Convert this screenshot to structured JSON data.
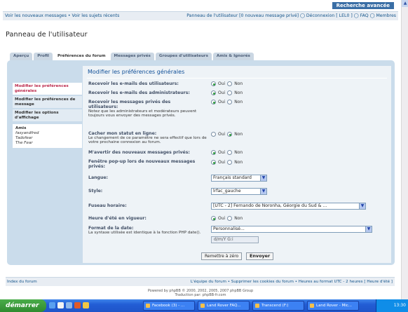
{
  "header": {
    "advanced_search": "Recherche avancée"
  },
  "navlinks": {
    "left": "Voir les nouveaux messages • Voir les sujets récents",
    "right": "Panneau de l'utilisateur [0 nouveau message privé] ◯ Déconnexion [ LEL0 ] ◯ FAQ ◯ Membres"
  },
  "page_title": "Panneau de l'utilisateur",
  "tabs": [
    "Aperçu",
    "Profil",
    "Préférences du forum",
    "Messages privés",
    "Groupes d'utilisateurs",
    "Amis & Ignorés"
  ],
  "sidebar": {
    "items": [
      "Modifier les préférences générales",
      "Modifier les préférences de message",
      "Modifier les options d'affichage"
    ],
    "friends_title": "Amis",
    "friends": [
      "fasyandfred",
      "Tadofear",
      "The Fear"
    ]
  },
  "form": {
    "heading": "Modifier les préférences générales",
    "rows": {
      "users_email": {
        "label": "Recevoir les e-mails des utilisateurs:"
      },
      "admin_email": {
        "label": "Recevoir les e-mails des administrateurs:"
      },
      "pm_users": {
        "label": "Recevoir les messages privés des utilisateurs:",
        "note": "Notez que les administrateurs et modérateurs peuvent toujours vous envoyer des messages privés."
      },
      "hide_online": {
        "label": "Cacher mon statut en ligne:",
        "note": "Le changement de ce paramètre ne sera effectif que lors de votre prochaine connexion au forum."
      },
      "notify_pm": {
        "label": "M'avertir des nouveaux messages privés:"
      },
      "popup_pm": {
        "label": "Fenêtre pop-up lors de nouveaux messages privés:"
      },
      "language": {
        "label": "Langue:",
        "value": "Français standard"
      },
      "style": {
        "label": "Style:",
        "value": "lrfac_gauche"
      },
      "timezone": {
        "label": "Fuseau horaire:",
        "value": "[UTC - 2] Fernando de Noronha, Géorgie du Sud & ..."
      },
      "dst": {
        "label": "Heure d'été en vigueur:"
      },
      "date_format": {
        "label": "Format de la date:",
        "note": "La syntaxe utilisée est identique à la fonction PHP date().",
        "value": "Personnalisé...",
        "custom": "d/m/Y G:i"
      }
    },
    "yes": "Oui",
    "no": "Non",
    "reset_button": "Remettre à zéro",
    "submit_button": "Envoyer"
  },
  "footer": {
    "left": "Index du forum",
    "right": "L'équipe du forum • Supprimer les cookies du forum • Heures au format UTC - 2 heures [ Heure d'été ]",
    "powered1": "Powered by phpBB © 2000, 2002, 2005, 2007 phpBB Group",
    "powered2": "Traduction par: phpBB-fr.com"
  },
  "taskbar": {
    "start": "démarrer",
    "items": [
      "Facebook (3) - ...",
      "Land Rover FAQ...",
      "Transcend (F:)",
      "Land Rover - Mic..."
    ],
    "clock": "13:30"
  }
}
